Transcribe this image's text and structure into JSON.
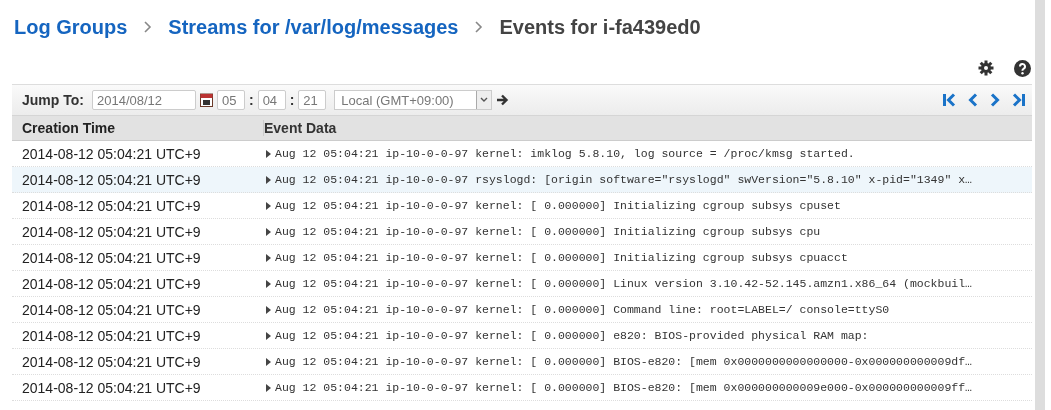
{
  "breadcrumb": [
    {
      "label": "Log Groups",
      "link": true
    },
    {
      "label": "Streams for /var/log/messages",
      "link": true
    },
    {
      "label": "Events for i-fa439ed0",
      "link": false
    }
  ],
  "toolbar": {
    "label": "Jump To:",
    "date": "2014/08/12",
    "hour": "05",
    "minute": "04",
    "second": "21",
    "separator": ":",
    "timezone": "Local (GMT+09:00)"
  },
  "table": {
    "columns": [
      "Creation Time",
      "Event Data"
    ],
    "rows": [
      {
        "time": "2014-08-12 05:04:21 UTC+9",
        "event": "Aug 12 05:04:21 ip-10-0-0-97 kernel: imklog 5.8.10, log source = /proc/kmsg started.",
        "selected": false
      },
      {
        "time": "2014-08-12 05:04:21 UTC+9",
        "event": "Aug 12 05:04:21 ip-10-0-0-97 rsyslogd: [origin software=\"rsyslogd\" swVersion=\"5.8.10\" x-pid=\"1349\" x…",
        "selected": true
      },
      {
        "time": "2014-08-12 05:04:21 UTC+9",
        "event": "Aug 12 05:04:21 ip-10-0-0-97 kernel: [ 0.000000] Initializing cgroup subsys cpuset",
        "selected": false
      },
      {
        "time": "2014-08-12 05:04:21 UTC+9",
        "event": "Aug 12 05:04:21 ip-10-0-0-97 kernel: [ 0.000000] Initializing cgroup subsys cpu",
        "selected": false
      },
      {
        "time": "2014-08-12 05:04:21 UTC+9",
        "event": "Aug 12 05:04:21 ip-10-0-0-97 kernel: [ 0.000000] Initializing cgroup subsys cpuacct",
        "selected": false
      },
      {
        "time": "2014-08-12 05:04:21 UTC+9",
        "event": "Aug 12 05:04:21 ip-10-0-0-97 kernel: [ 0.000000] Linux version 3.10.42-52.145.amzn1.x86_64 (mockbuil…",
        "selected": false
      },
      {
        "time": "2014-08-12 05:04:21 UTC+9",
        "event": "Aug 12 05:04:21 ip-10-0-0-97 kernel: [ 0.000000] Command line: root=LABEL=/ console=ttyS0",
        "selected": false
      },
      {
        "time": "2014-08-12 05:04:21 UTC+9",
        "event": "Aug 12 05:04:21 ip-10-0-0-97 kernel: [ 0.000000] e820: BIOS-provided physical RAM map:",
        "selected": false
      },
      {
        "time": "2014-08-12 05:04:21 UTC+9",
        "event": "Aug 12 05:04:21 ip-10-0-0-97 kernel: [ 0.000000] BIOS-e820: [mem 0x0000000000000000-0x000000000009df…",
        "selected": false
      },
      {
        "time": "2014-08-12 05:04:21 UTC+9",
        "event": "Aug 12 05:04:21 ip-10-0-0-97 kernel: [ 0.000000] BIOS-e820: [mem 0x000000000009e000-0x000000000009ff…",
        "selected": false
      }
    ]
  }
}
